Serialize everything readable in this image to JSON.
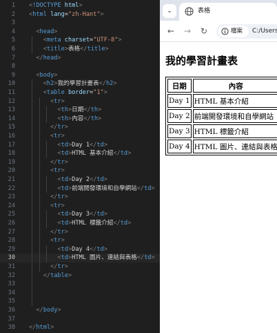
{
  "editor": {
    "lines": [
      {
        "n": "1",
        "parts": [
          [
            "br",
            "<"
          ],
          [
            "tg",
            "!DOCTYPE"
          ],
          [
            "tx",
            " "
          ],
          [
            "at",
            "html"
          ],
          [
            "br",
            ">"
          ]
        ]
      },
      {
        "n": "2",
        "parts": [
          [
            "br",
            "<"
          ],
          [
            "tg",
            "html"
          ],
          [
            "tx",
            " "
          ],
          [
            "at",
            "lang"
          ],
          [
            "tx",
            "="
          ],
          [
            "st",
            "\"zh-Hant\""
          ],
          [
            "br",
            ">"
          ]
        ]
      },
      {
        "n": "3",
        "parts": []
      },
      {
        "n": "4",
        "parts": [
          [
            "tx",
            "  "
          ],
          [
            "br",
            "<"
          ],
          [
            "tg",
            "head"
          ],
          [
            "br",
            ">"
          ]
        ]
      },
      {
        "n": "5",
        "parts": [
          [
            "tx",
            "    "
          ],
          [
            "br",
            "<"
          ],
          [
            "tg",
            "meta"
          ],
          [
            "tx",
            " "
          ],
          [
            "at",
            "charset"
          ],
          [
            "tx",
            "="
          ],
          [
            "st",
            "\"UTF-8\""
          ],
          [
            "br",
            ">"
          ]
        ]
      },
      {
        "n": "6",
        "parts": [
          [
            "tx",
            "    "
          ],
          [
            "br",
            "<"
          ],
          [
            "tg",
            "title"
          ],
          [
            "br",
            ">"
          ],
          [
            "tx",
            "表格"
          ],
          [
            "br",
            "</"
          ],
          [
            "tg",
            "title"
          ],
          [
            "br",
            ">"
          ]
        ]
      },
      {
        "n": "7",
        "parts": [
          [
            "tx",
            "  "
          ],
          [
            "br",
            "</"
          ],
          [
            "tg",
            "head"
          ],
          [
            "br",
            ">"
          ]
        ]
      },
      {
        "n": "8",
        "parts": []
      },
      {
        "n": "9",
        "parts": [
          [
            "tx",
            "  "
          ],
          [
            "br",
            "<"
          ],
          [
            "tg",
            "body"
          ],
          [
            "br",
            ">"
          ]
        ]
      },
      {
        "n": "10",
        "parts": [
          [
            "tx",
            "    "
          ],
          [
            "br",
            "<"
          ],
          [
            "tg",
            "h2"
          ],
          [
            "br",
            ">"
          ],
          [
            "tx",
            "我的學習計畫表"
          ],
          [
            "br",
            "</"
          ],
          [
            "tg",
            "h2"
          ],
          [
            "br",
            ">"
          ]
        ]
      },
      {
        "n": "11",
        "parts": [
          [
            "tx",
            "    "
          ],
          [
            "br",
            "<"
          ],
          [
            "tg",
            "table"
          ],
          [
            "tx",
            " "
          ],
          [
            "at",
            "border"
          ],
          [
            "tx",
            "="
          ],
          [
            "st",
            "\"1\""
          ],
          [
            "br",
            ">"
          ]
        ]
      },
      {
        "n": "12",
        "parts": [
          [
            "tx",
            "      "
          ],
          [
            "br",
            "<"
          ],
          [
            "tg",
            "tr"
          ],
          [
            "br",
            ">"
          ]
        ]
      },
      {
        "n": "13",
        "parts": [
          [
            "tx",
            "        "
          ],
          [
            "br",
            "<"
          ],
          [
            "tg",
            "th"
          ],
          [
            "br",
            ">"
          ],
          [
            "tx",
            "日期"
          ],
          [
            "br",
            "</"
          ],
          [
            "tg",
            "th"
          ],
          [
            "br",
            ">"
          ]
        ]
      },
      {
        "n": "14",
        "parts": [
          [
            "tx",
            "        "
          ],
          [
            "br",
            "<"
          ],
          [
            "tg",
            "th"
          ],
          [
            "br",
            ">"
          ],
          [
            "tx",
            "內容"
          ],
          [
            "br",
            "</"
          ],
          [
            "tg",
            "th"
          ],
          [
            "br",
            ">"
          ]
        ]
      },
      {
        "n": "15",
        "parts": [
          [
            "tx",
            "      "
          ],
          [
            "br",
            "</"
          ],
          [
            "tg",
            "tr"
          ],
          [
            "br",
            ">"
          ]
        ]
      },
      {
        "n": "16",
        "parts": [
          [
            "tx",
            "      "
          ],
          [
            "br",
            "<"
          ],
          [
            "tg",
            "tr"
          ],
          [
            "br",
            ">"
          ]
        ]
      },
      {
        "n": "17",
        "parts": [
          [
            "tx",
            "        "
          ],
          [
            "br",
            "<"
          ],
          [
            "tg",
            "td"
          ],
          [
            "br",
            ">"
          ],
          [
            "tx",
            "Day 1"
          ],
          [
            "br",
            "</"
          ],
          [
            "tg",
            "td"
          ],
          [
            "br",
            ">"
          ]
        ]
      },
      {
        "n": "18",
        "parts": [
          [
            "tx",
            "        "
          ],
          [
            "br",
            "<"
          ],
          [
            "tg",
            "td"
          ],
          [
            "br",
            ">"
          ],
          [
            "tx",
            "HTML 基本介紹"
          ],
          [
            "br",
            "</"
          ],
          [
            "tg",
            "td"
          ],
          [
            "br",
            ">"
          ]
        ]
      },
      {
        "n": "19",
        "parts": [
          [
            "tx",
            "      "
          ],
          [
            "br",
            "</"
          ],
          [
            "tg",
            "tr"
          ],
          [
            "br",
            ">"
          ]
        ]
      },
      {
        "n": "20",
        "parts": [
          [
            "tx",
            "      "
          ],
          [
            "br",
            "<"
          ],
          [
            "tg",
            "tr"
          ],
          [
            "br",
            ">"
          ]
        ]
      },
      {
        "n": "21",
        "parts": [
          [
            "tx",
            "        "
          ],
          [
            "br",
            "<"
          ],
          [
            "tg",
            "td"
          ],
          [
            "br",
            ">"
          ],
          [
            "tx",
            "Day 2"
          ],
          [
            "br",
            "</"
          ],
          [
            "tg",
            "td"
          ],
          [
            "br",
            ">"
          ]
        ]
      },
      {
        "n": "22",
        "parts": [
          [
            "tx",
            "        "
          ],
          [
            "br",
            "<"
          ],
          [
            "tg",
            "td"
          ],
          [
            "br",
            ">"
          ],
          [
            "tx",
            "前端開發環境和自學網站"
          ],
          [
            "br",
            "</"
          ],
          [
            "tg",
            "td"
          ],
          [
            "br",
            ">"
          ]
        ]
      },
      {
        "n": "23",
        "parts": [
          [
            "tx",
            "      "
          ],
          [
            "br",
            "</"
          ],
          [
            "tg",
            "tr"
          ],
          [
            "br",
            ">"
          ]
        ]
      },
      {
        "n": "24",
        "parts": [
          [
            "tx",
            "      "
          ],
          [
            "br",
            "<"
          ],
          [
            "tg",
            "tr"
          ],
          [
            "br",
            ">"
          ]
        ]
      },
      {
        "n": "25",
        "parts": [
          [
            "tx",
            "        "
          ],
          [
            "br",
            "<"
          ],
          [
            "tg",
            "td"
          ],
          [
            "br",
            ">"
          ],
          [
            "tx",
            "Day 3"
          ],
          [
            "br",
            "</"
          ],
          [
            "tg",
            "td"
          ],
          [
            "br",
            ">"
          ]
        ]
      },
      {
        "n": "26",
        "parts": [
          [
            "tx",
            "        "
          ],
          [
            "br",
            "<"
          ],
          [
            "tg",
            "td"
          ],
          [
            "br",
            ">"
          ],
          [
            "tx",
            "HTML 標籤介紹"
          ],
          [
            "br",
            "</"
          ],
          [
            "tg",
            "td"
          ],
          [
            "br",
            ">"
          ]
        ]
      },
      {
        "n": "27",
        "parts": [
          [
            "tx",
            "      "
          ],
          [
            "br",
            "</"
          ],
          [
            "tg",
            "tr"
          ],
          [
            "br",
            ">"
          ]
        ]
      },
      {
        "n": "28",
        "parts": [
          [
            "tx",
            "      "
          ],
          [
            "br",
            "<"
          ],
          [
            "tg",
            "tr"
          ],
          [
            "br",
            ">"
          ]
        ]
      },
      {
        "n": "29",
        "parts": [
          [
            "tx",
            "        "
          ],
          [
            "br",
            "<"
          ],
          [
            "tg",
            "td"
          ],
          [
            "br",
            ">"
          ],
          [
            "tx",
            "Day 4"
          ],
          [
            "br",
            "</"
          ],
          [
            "tg",
            "td"
          ],
          [
            "br",
            ">"
          ]
        ]
      },
      {
        "n": "30",
        "parts": [
          [
            "tx",
            "        "
          ],
          [
            "br",
            "<"
          ],
          [
            "tg",
            "td"
          ],
          [
            "br",
            ">"
          ],
          [
            "tx",
            "HTML 圖片、連結與表格"
          ],
          [
            "br",
            "</"
          ],
          [
            "tg",
            "td"
          ],
          [
            "br",
            ">"
          ]
        ]
      },
      {
        "n": "31",
        "parts": [
          [
            "tx",
            "      "
          ],
          [
            "br",
            "</"
          ],
          [
            "tg",
            "tr"
          ],
          [
            "br",
            ">"
          ]
        ]
      },
      {
        "n": "32",
        "parts": [
          [
            "tx",
            "    "
          ],
          [
            "br",
            "</"
          ],
          [
            "tg",
            "table"
          ],
          [
            "br",
            ">"
          ]
        ]
      },
      {
        "n": "33",
        "parts": []
      },
      {
        "n": "34",
        "parts": []
      },
      {
        "n": "35",
        "parts": []
      },
      {
        "n": "36",
        "parts": [
          [
            "tx",
            "  "
          ],
          [
            "br",
            "</"
          ],
          [
            "tg",
            "body"
          ],
          [
            "br",
            ">"
          ]
        ]
      },
      {
        "n": "37",
        "parts": []
      },
      {
        "n": "38",
        "parts": [
          [
            "br",
            "</"
          ],
          [
            "tg",
            "html"
          ],
          [
            "br",
            ">"
          ]
        ]
      }
    ],
    "active_line": "30"
  },
  "browser": {
    "tab_title": "表格",
    "tab_menu_icon": "chevron-down-icon",
    "nav": {
      "back": "←",
      "forward": "→",
      "reload": "↻"
    },
    "site_chip_label": "檔案",
    "url": "C:/Users/",
    "page": {
      "heading": "我的學習計畫表",
      "table": {
        "headers": [
          "日期",
          "內容"
        ],
        "rows": [
          [
            "Day 1",
            "HTML 基本介紹"
          ],
          [
            "Day 2",
            "前端開發環境和自學網站"
          ],
          [
            "Day 3",
            "HTML 標籤介紹"
          ],
          [
            "Day 4",
            "HTML 圖片、連結與表格"
          ]
        ]
      }
    }
  }
}
